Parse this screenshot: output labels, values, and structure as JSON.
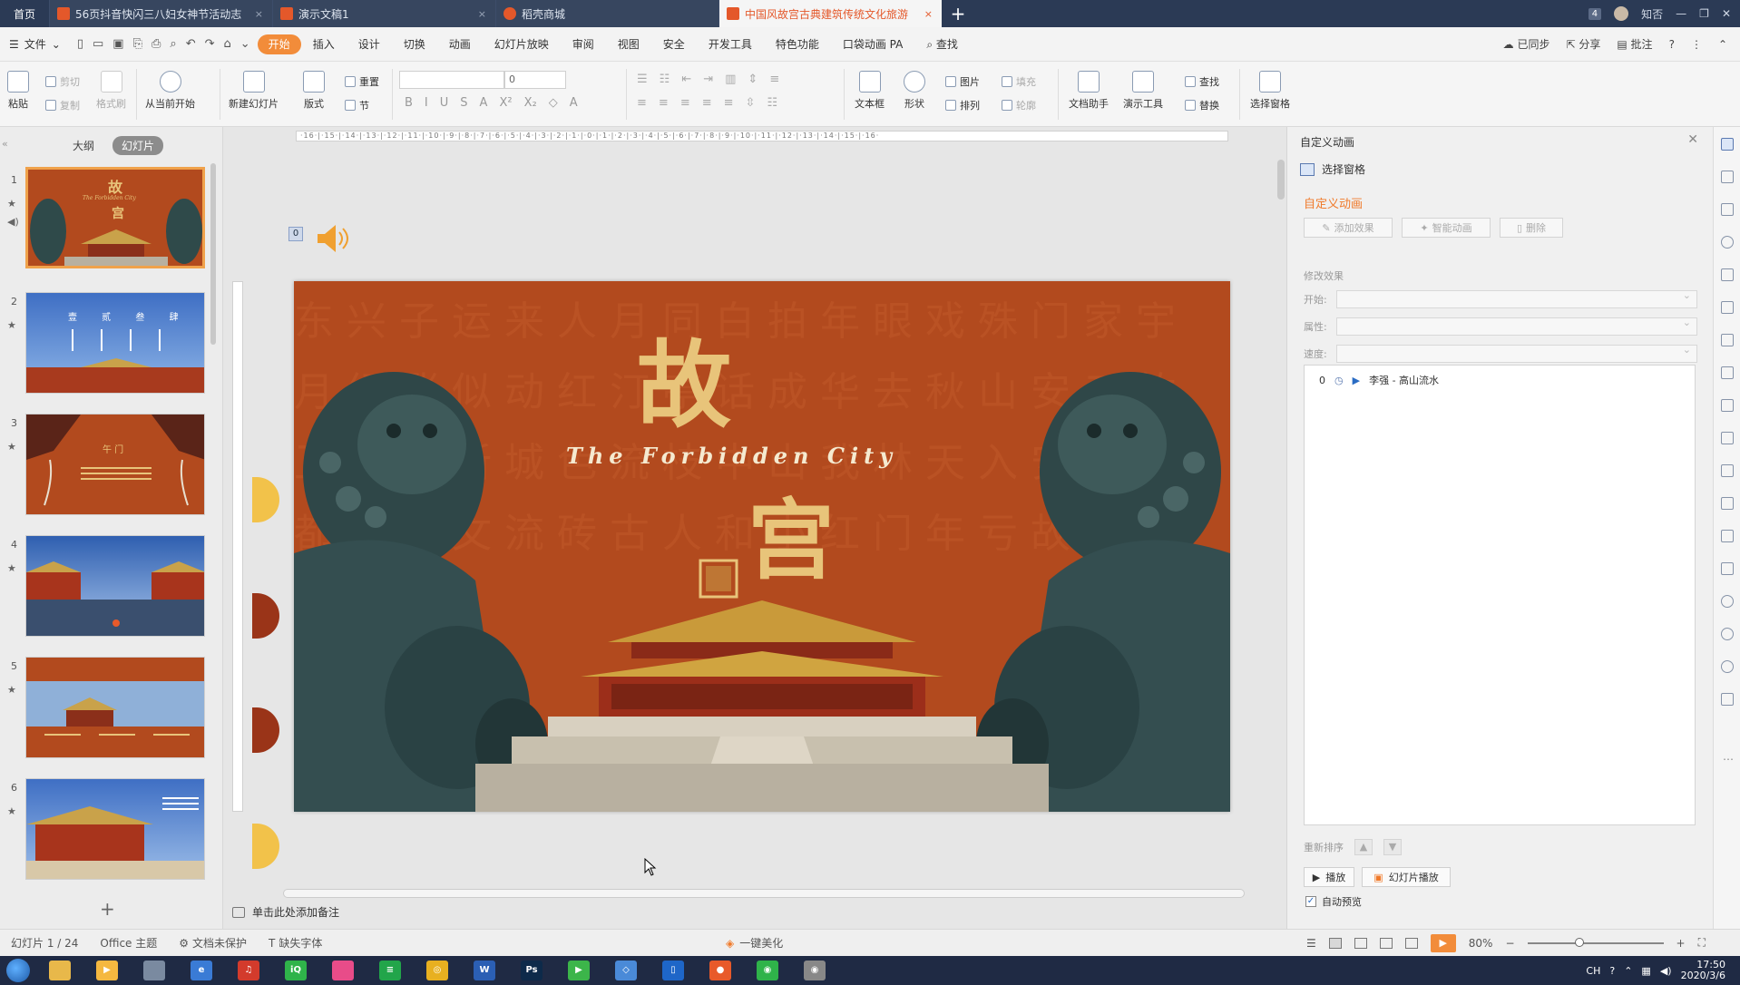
{
  "tabs": {
    "home": "首页",
    "docs": [
      {
        "title": "56页抖音快闪三八妇女神节活动志",
        "icon_color": "#e4582a",
        "active": false
      },
      {
        "title": "演示文稿1",
        "icon_color": "#e4582a",
        "active": false
      },
      {
        "title": "稻壳商城",
        "icon_color": "#e4582a",
        "active": false
      },
      {
        "title": "中国风故宫古典建筑传统文化旅游",
        "icon_color": "#e4582a",
        "active": true
      }
    ],
    "close_glyph": "×",
    "add_glyph": "+",
    "window_count": "4",
    "user": "知否"
  },
  "menubar": {
    "file": "文件",
    "tabs": [
      "开始",
      "插入",
      "设计",
      "切换",
      "动画",
      "幻灯片放映",
      "审阅",
      "视图",
      "安全",
      "开发工具",
      "特色功能",
      "口袋动画 PA"
    ],
    "search": "查找",
    "sync": "已同步",
    "share": "分享",
    "comment": "批注",
    "help": "?"
  },
  "ribbon": {
    "paste": "粘贴",
    "cut": "剪切",
    "copy": "复制",
    "format_painter": "格式刷",
    "from_current": "从当前开始",
    "new_slide": "新建幻灯片",
    "layout": "版式",
    "reset": "重置",
    "section": "节",
    "font_size": "0",
    "textbox": "文本框",
    "shape": "形状",
    "picture": "图片",
    "fill": "填充",
    "arrange": "排列",
    "outline": "轮廓",
    "doc_helper": "文档助手",
    "present_tool": "演示工具",
    "find": "查找",
    "replace": "替换",
    "select_pane": "选择窗格",
    "format_glyphs": [
      "B",
      "I",
      "U",
      "S",
      "A",
      "X²",
      "X₂",
      "◇",
      "A"
    ]
  },
  "leftpanel": {
    "outline_tab": "大纲",
    "slides_tab": "幻灯片",
    "collapse": "«",
    "add": "+",
    "star": "★",
    "sound": "◀)",
    "slides": [
      {
        "num": "1",
        "title": "故",
        "title2": "宫",
        "sub": "The Forbidden City"
      },
      {
        "num": "2",
        "title": "壹 贰 叁 肆"
      },
      {
        "num": "3",
        "title": "午 门"
      },
      {
        "num": "4",
        "title": ""
      },
      {
        "num": "5",
        "title": ""
      },
      {
        "num": "6",
        "title": ""
      }
    ]
  },
  "center": {
    "ruler": "·16·|·15·|·14·|·13·|·12·|·11·|·10·|·9·|·8·|·7·|·6·|·5·|·4·|·3·|·2·|·1·|·0·|·1·|·2·|·3·|·4·|·5·|·6·|·7·|·8·|·9·|·10·|·11·|·12·|·13·|·14·|·15·|·16·",
    "anim_tag": "0",
    "notes_placeholder": "单击此处添加备注"
  },
  "slide": {
    "title_char1": "故",
    "title_char2": "宫",
    "subtitle": "The Forbidden City",
    "bg_color": "#b24a1e",
    "gold": "#e8c47a",
    "bg_glyphs": "东兴子运来人月同白拍年眼戏殊门家宇月经涨似动红汀亭话成华去秋山安三竹卫中上新城色流枝中山我林天入安白人都兴吧文流砖古人和小红门年亏故"
  },
  "rightpane": {
    "title": "自定义动画",
    "select_pane": "选择窗格",
    "section": "自定义动画",
    "add_effect": "添加效果",
    "smart_anim": "智能动画",
    "delete": "删除",
    "modify": "修改效果",
    "start": "开始:",
    "property": "属性:",
    "speed": "速度:",
    "item_index": "0",
    "item_text": "李强 - 高山流水",
    "reorder": "重新排序",
    "play": "播放",
    "slideshow": "幻灯片播放",
    "auto_preview": "自动预览",
    "close": "✕"
  },
  "statusbar": {
    "slide_info": "幻灯片 1 / 24",
    "theme": "Office 主题",
    "protect": "文档未保护",
    "missing_font": "缺失字体",
    "beautify": "一键美化",
    "zoom": "80%",
    "minus": "−",
    "plus": "+"
  },
  "taskbar": {
    "clock_time": "17:50",
    "clock_date": "2020/3/6",
    "ime": "CH",
    "apps": [
      {
        "name": "explorer",
        "color": "#e8b84a",
        "label": ""
      },
      {
        "name": "media",
        "color": "#f5b840",
        "label": "▶"
      },
      {
        "name": "app3",
        "color": "#7a8aa0",
        "label": ""
      },
      {
        "name": "browser",
        "color": "#3a7bd5",
        "label": "e"
      },
      {
        "name": "netease",
        "color": "#d33b2c",
        "label": "♫"
      },
      {
        "name": "iqiyi",
        "color": "#2fb34a",
        "label": "iQ"
      },
      {
        "name": "app7",
        "color": "#e84c89",
        "label": ""
      },
      {
        "name": "app8",
        "color": "#22a54a",
        "label": "≡"
      },
      {
        "name": "chrome",
        "color": "#e8b020",
        "label": "◎"
      },
      {
        "name": "word",
        "color": "#2b5fb4",
        "label": "W"
      },
      {
        "name": "photoshop",
        "color": "#0d2a4a",
        "label": "Ps"
      },
      {
        "name": "player",
        "color": "#3cb54a",
        "label": "▶"
      },
      {
        "name": "app13",
        "color": "#4a8ad8",
        "label": "◇"
      },
      {
        "name": "app14",
        "color": "#1e66c8",
        "label": "▯"
      },
      {
        "name": "app15",
        "color": "#e85a2a",
        "label": "●"
      },
      {
        "name": "wechat",
        "color": "#2fb34a",
        "label": "◉"
      },
      {
        "name": "app17",
        "color": "#888888",
        "label": "◉"
      }
    ]
  }
}
